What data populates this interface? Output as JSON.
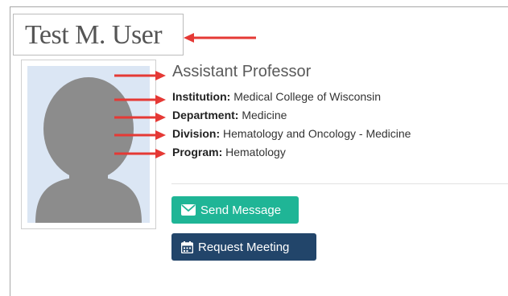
{
  "profile": {
    "name": "Test M. User",
    "title": "Assistant Professor",
    "details": [
      {
        "label": "Institution:",
        "value": "Medical College of Wisconsin"
      },
      {
        "label": "Department:",
        "value": "Medicine"
      },
      {
        "label": "Division:",
        "value": "Hematology and Oncology - Medicine"
      },
      {
        "label": "Program:",
        "value": "Hematology"
      }
    ]
  },
  "actions": {
    "send_message": "Send Message",
    "request_meeting": "Request Meeting"
  },
  "icons": {
    "send_message": "envelope-icon",
    "request_meeting": "calendar-icon",
    "avatar": "person-silhouette"
  },
  "colors": {
    "send_button": "#1fb596",
    "meeting_button": "#22456a",
    "annotation_arrow": "#e53935",
    "photo_background": "#dbe6f4"
  }
}
